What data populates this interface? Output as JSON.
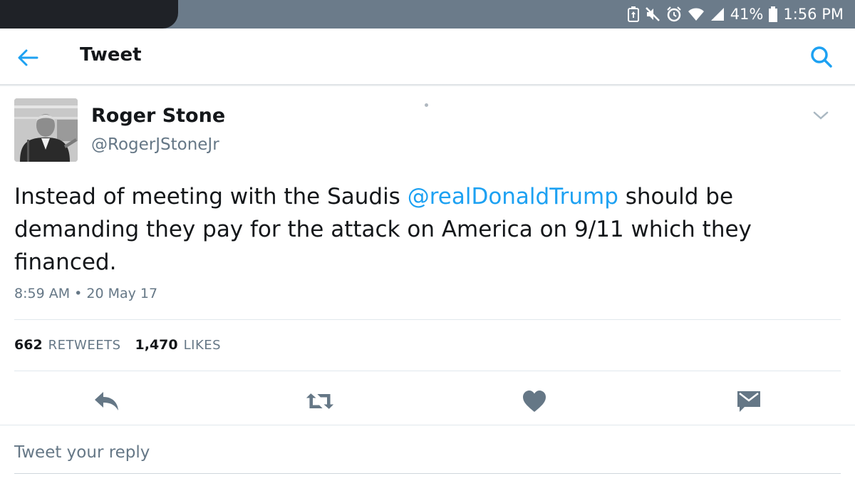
{
  "status_bar": {
    "battery_percent": "41%",
    "time": "1:56 PM"
  },
  "app_bar": {
    "title": "Tweet",
    "back_icon": "arrow-left-icon",
    "search_icon": "search-icon"
  },
  "tweet": {
    "display_name": "Roger Stone",
    "handle": "@RogerJStoneJr",
    "text_before": "Instead of meeting with the Saudis ",
    "mention": "@realDonaldTrump",
    "text_after": " should be demanding they pay for the attack on America on 9/11 which they financed.",
    "timestamp": "8:59 AM • 20 May 17",
    "retweets_count": "662",
    "retweets_label": "RETWEETS",
    "likes_count": "1,470",
    "likes_label": "LIKES"
  },
  "actions": [
    "reply-icon",
    "retweet-icon",
    "heart-icon",
    "direct-message-icon"
  ],
  "reply": {
    "placeholder": "Tweet your reply"
  },
  "colors": {
    "status_bar": "#6b7b8a",
    "accent": "#1da1f2",
    "secondary_text": "#657786",
    "action_icon": "#657786"
  }
}
